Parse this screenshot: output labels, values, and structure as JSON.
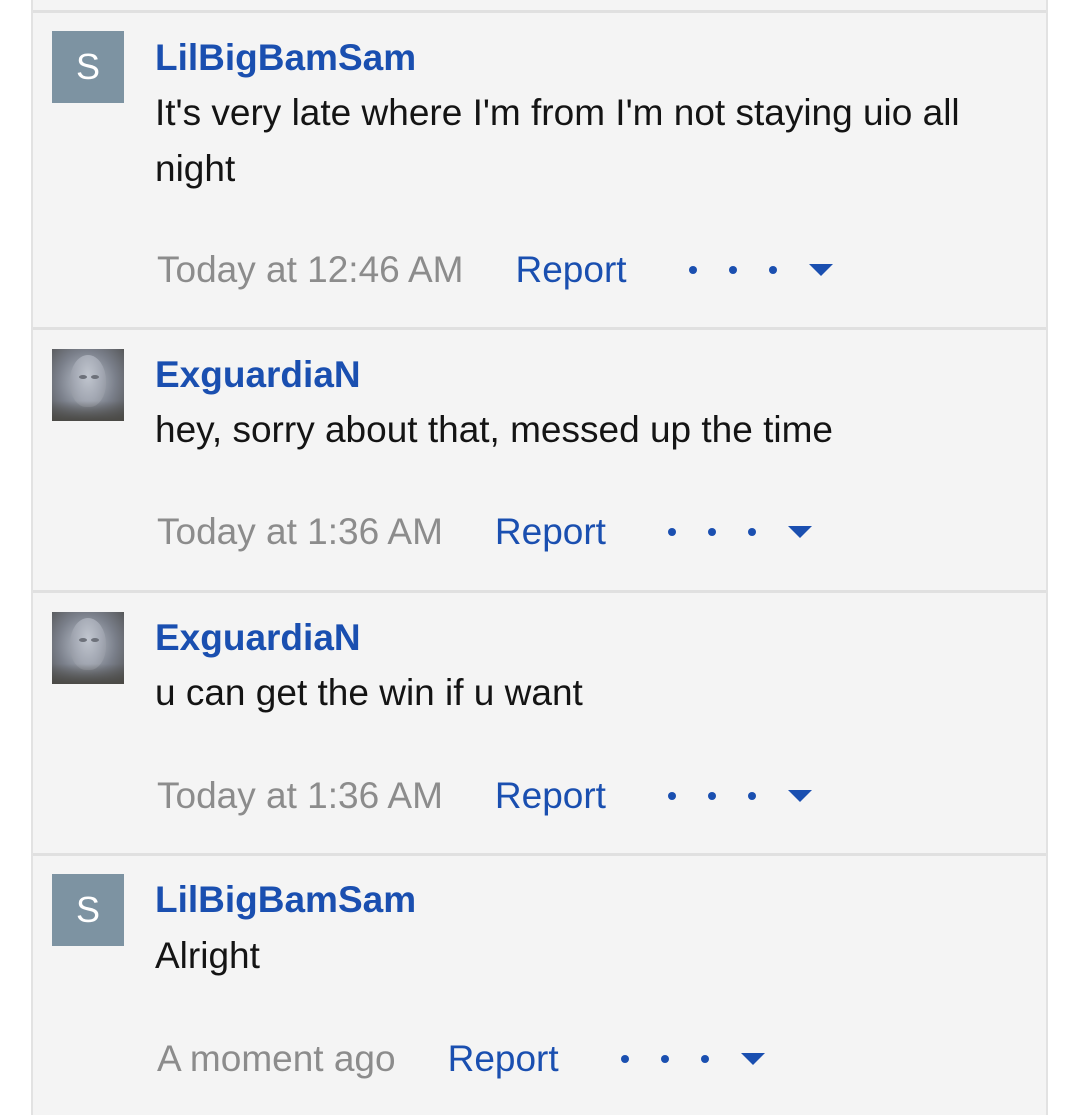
{
  "messages": [
    {
      "author": "LilBigBamSam",
      "avatar_letter": "S",
      "avatar_type": "letter",
      "text": "It's very late where I'm from I'm not staying uio all night",
      "timestamp": "Today at 12:46 AM",
      "report_label": "Report",
      "more_icon": "more-options-icon"
    },
    {
      "author": "ExguardiaN",
      "avatar_type": "photo",
      "text": "hey, sorry about that, messed up the time",
      "timestamp": "Today at 1:36 AM",
      "report_label": "Report",
      "more_icon": "more-options-icon"
    },
    {
      "author": "ExguardiaN",
      "avatar_type": "photo",
      "text": "u can get the win if u want",
      "timestamp": "Today at 1:36 AM",
      "report_label": "Report",
      "more_icon": "more-options-icon"
    },
    {
      "author": "LilBigBamSam",
      "avatar_letter": "S",
      "avatar_type": "letter",
      "text": "Alright",
      "timestamp": "A moment ago",
      "report_label": "Report",
      "more_icon": "more-options-icon"
    }
  ],
  "colors": {
    "link": "#1a4fb0",
    "timestamp": "#8c8c8c",
    "avatar_letter_bg": "#7d93a2",
    "panel_bg": "#f4f4f4"
  }
}
